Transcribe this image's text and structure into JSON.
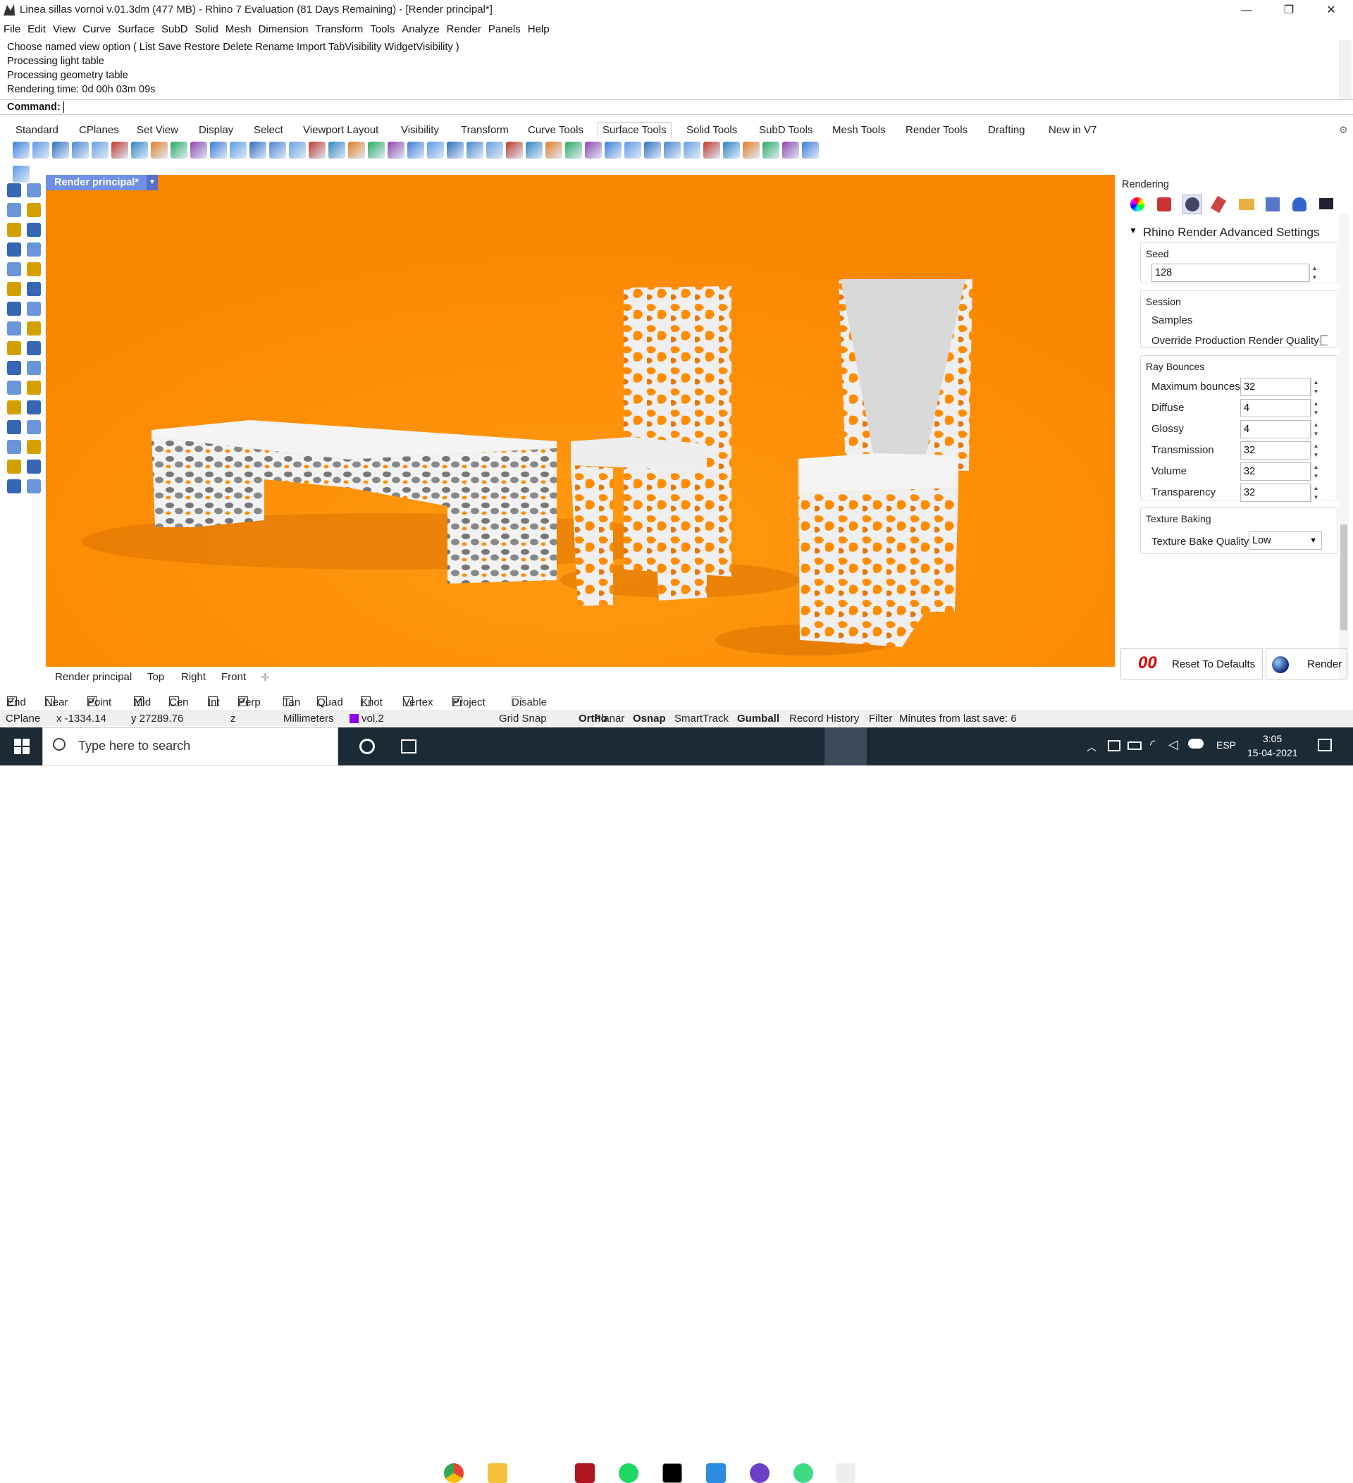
{
  "window": {
    "title": "Linea sillas vornoi v.01.3dm (477 MB) - Rhino 7 Evaluation (81 Days Remaining) - [Render principal*]",
    "controls": [
      "—",
      "❐",
      "✕"
    ]
  },
  "menu": [
    "File",
    "Edit",
    "View",
    "Curve",
    "Surface",
    "SubD",
    "Solid",
    "Mesh",
    "Dimension",
    "Transform",
    "Tools",
    "Analyze",
    "Render",
    "Panels",
    "Help"
  ],
  "history": [
    "Choose named view option ( List  Save  Restore  Delete  Rename  Import  TabVisibility  WidgetVisibility )",
    "Processing light table",
    "Processing geometry table",
    "Rendering time: 0d 00h 03m 09s"
  ],
  "command": {
    "label": "Command:",
    "value": ""
  },
  "toolbar_tabs": [
    "Standard",
    "CPlanes",
    "Set View",
    "Display",
    "Select",
    "Viewport Layout",
    "Visibility",
    "Transform",
    "Curve Tools",
    "Surface Tools",
    "Solid Tools",
    "SubD Tools",
    "Mesh Tools",
    "Render Tools",
    "Drafting",
    "New in V7"
  ],
  "active_toolbar_tab": "Surface Tools",
  "viewport": {
    "title": "Render principal*",
    "tabs": [
      "Render principal",
      "Top",
      "Right",
      "Front"
    ],
    "background": "#ff8c00"
  },
  "panel": {
    "header": "Rendering",
    "section_title": "Rhino Render Advanced Settings",
    "seed": {
      "label": "Seed",
      "value": "128"
    },
    "session": {
      "label": "Session",
      "samples_label": "Samples",
      "override_label": "Override Production Render Quality"
    },
    "ray_bounces": {
      "label": "Ray Bounces",
      "rows": [
        {
          "label": "Maximum bounces",
          "value": "32"
        },
        {
          "label": "Diffuse",
          "value": "4"
        },
        {
          "label": "Glossy",
          "value": "4"
        },
        {
          "label": "Transmission",
          "value": "32"
        },
        {
          "label": "Volume",
          "value": "32"
        },
        {
          "label": "Transparency",
          "value": "32"
        }
      ]
    },
    "texture_baking": {
      "label": "Texture Baking",
      "quality_label": "Texture Bake Quality",
      "quality_value": "Low"
    },
    "reset_label": "Reset To Defaults",
    "render_label": "Render"
  },
  "osnaps": [
    {
      "label": "End",
      "checked": true
    },
    {
      "label": "Near",
      "checked": false
    },
    {
      "label": "Point",
      "checked": true
    },
    {
      "label": "Mid",
      "checked": true
    },
    {
      "label": "Cen",
      "checked": false
    },
    {
      "label": "Int",
      "checked": false
    },
    {
      "label": "Perp",
      "checked": true
    },
    {
      "label": "Tan",
      "checked": false
    },
    {
      "label": "Quad",
      "checked": false
    },
    {
      "label": "Knot",
      "checked": false
    },
    {
      "label": "Vertex",
      "checked": false
    },
    {
      "label": "Project",
      "checked": true
    },
    {
      "label": "Disable",
      "checked": false
    }
  ],
  "status": {
    "cplane": "CPlane",
    "x": "x -1334.14",
    "y": "y 27289.76",
    "z": "z",
    "units": "Millimeters",
    "layer": "vol.2",
    "grid_snap": "Grid Snap",
    "ortho": "Ortho",
    "planar": "Planar",
    "osnap": "Osnap",
    "smarttrack": "SmartTrack",
    "gumball": "Gumball",
    "record_history": "Record History",
    "filter": "Filter",
    "minutes": "Minutes from last save: 6"
  },
  "taskbar": {
    "search_placeholder": "Type here to search",
    "lang": "ESP",
    "time": "3:05",
    "date": "15-04-2021"
  }
}
